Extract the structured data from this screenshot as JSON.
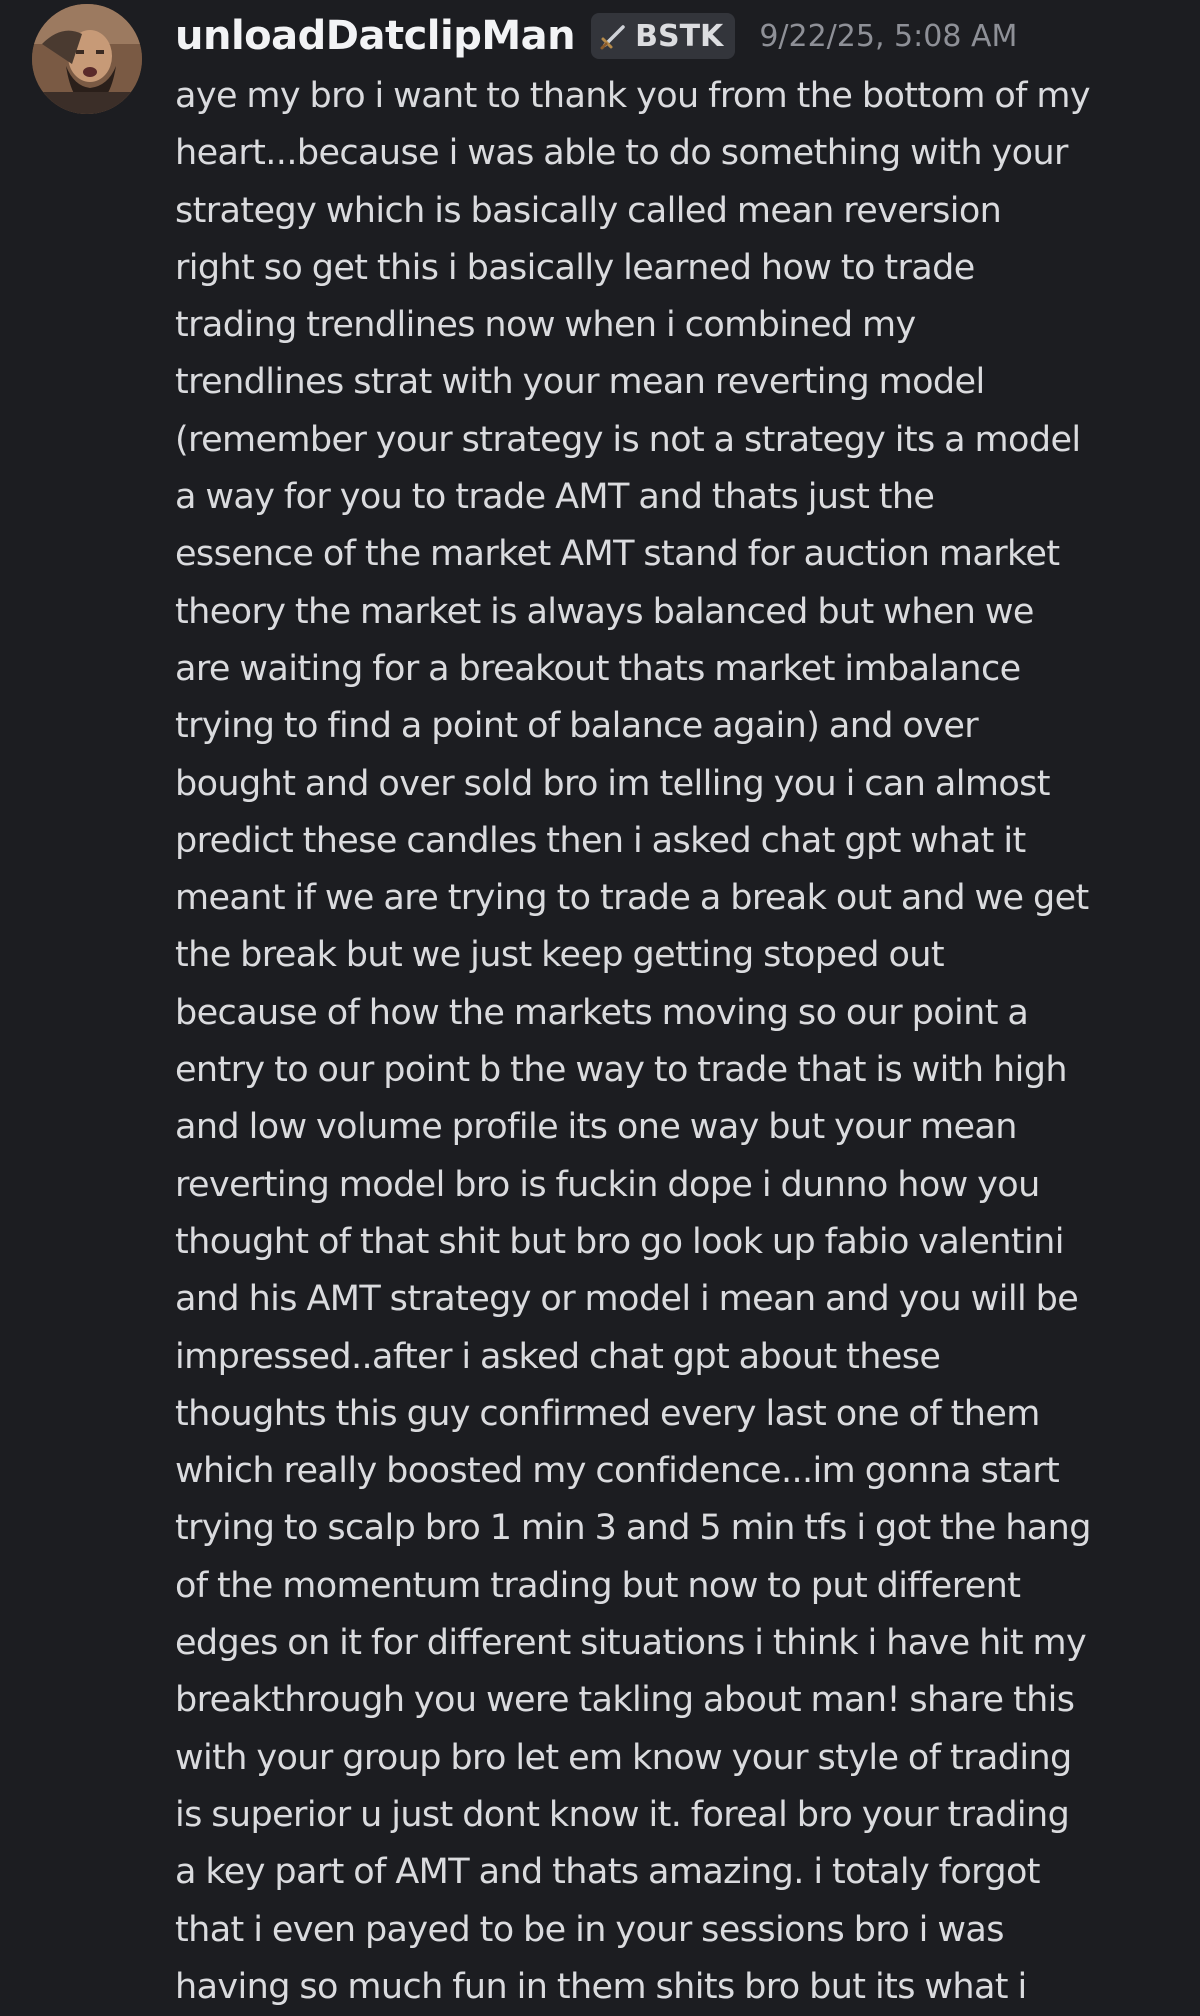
{
  "message": {
    "author": "unloadDatclipMan",
    "tag": {
      "icon": "sword-icon",
      "label": "BSTK"
    },
    "timestamp": "9/22/25, 5:08 AM",
    "lines": [
      "aye my bro i want to thank you from the bottom of my",
      "heart...because i was able to do something with your",
      "strategy which is basically called mean reversion",
      "right so get this i basically learned how to trade",
      "trading trendlines now when i combined my",
      "trendlines strat with your mean reverting model",
      "(remember your strategy is not a strategy its a model",
      "a way for you to trade AMT and thats just the",
      "essence of the market AMT stand for auction market",
      "theory the market is always balanced but when we",
      "are waiting for a breakout thats market imbalance",
      "trying to find a point of balance again) and over",
      "bought and over sold bro im telling you i can almost",
      "predict these candles then i asked chat gpt what it",
      "meant if we are trying to trade a break out and we get",
      "the break but we just keep getting stoped out",
      "because of how the markets moving so our point a",
      "entry to our point b the way to trade that is with high",
      "and low volume profile its one way but your mean",
      "reverting model bro is fuckin dope i dunno how you",
      "thought of that shit but bro go look up fabio valentini",
      "and his AMT strategy or model i mean and you will be",
      "impressed..after i asked chat gpt about these",
      "thoughts this guy confirmed every last one of them",
      "which really boosted my confidence...im gonna start",
      "trying to scalp bro 1 min 3 and 5 min tfs i got the hang",
      "of the momentum trading but now to put different",
      "edges on it for different situations i think i have hit my",
      "breakthrough you were takling about man! share this",
      "with your group bro let em know your style of trading",
      "is superior u just dont know it. foreal bro your trading",
      "a key part of AMT and thats amazing. i totaly forgot",
      "that i even payed to be in your sessions bro i was",
      "having so much fun in them shits bro but its what i"
    ]
  },
  "colors": {
    "background": "#1c1d21",
    "username": "#f2f3f5",
    "text": "#dadbde",
    "timestamp": "#8e9097",
    "tag_background": "#33353b"
  }
}
